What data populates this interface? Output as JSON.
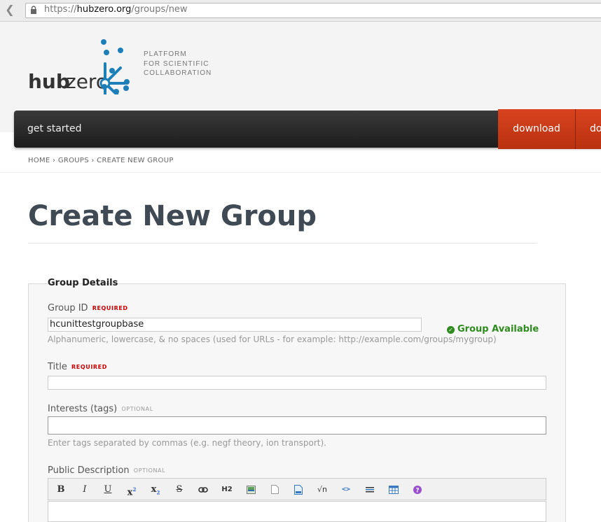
{
  "browser": {
    "url_prefix": "https://",
    "url_domain": "hubzero.org",
    "url_path": "/groups/new"
  },
  "header": {
    "logo_text_hub": "hub",
    "logo_text_zero": "zero",
    "tagline": [
      "PLATFORM",
      "FOR SCIENTIFIC",
      "COLLABORATION"
    ],
    "nav_label": "get started",
    "download_label": "download",
    "truncated_label": "do"
  },
  "breadcrumb": [
    "HOME",
    "GROUPS",
    "CREATE NEW GROUP"
  ],
  "page_title": "Create New Group",
  "form": {
    "legend": "Group Details",
    "group_id": {
      "label": "Group ID",
      "badge": "REQUIRED",
      "value": "hcunittestgroupbase",
      "hint": "Alphanumeric, lowercase, & no spaces (used for URLs - for example: http://example.com/groups/mygroup)",
      "status": "Group Available"
    },
    "title": {
      "label": "Title",
      "badge": "REQUIRED",
      "value": ""
    },
    "interests": {
      "label": "Interests (tags)",
      "badge": "OPTIONAL",
      "value": "",
      "hint": "Enter tags separated by commas (e.g. negf theory, ion transport)."
    },
    "description": {
      "label": "Public Description",
      "badge": "OPTIONAL"
    }
  },
  "toolbar": {
    "bold": "B",
    "italic": "I",
    "underline": "U",
    "superscript": "x",
    "subscript": "x",
    "strike": "S",
    "heading": "H2",
    "math": "√n",
    "code": "<>",
    "icons": [
      "bold-icon",
      "italic-icon",
      "underline-icon",
      "superscript-icon",
      "subscript-icon",
      "strikethrough-icon",
      "link-icon",
      "heading-icon",
      "image-icon",
      "file-icon",
      "page-icon",
      "math-icon",
      "code-icon",
      "horizontal-rule-icon",
      "table-icon",
      "help-icon"
    ]
  },
  "colors": {
    "accent": "#c9391a",
    "success": "#2e8b1e",
    "required": "#cc0000",
    "logo_blue": "#1c7fb7",
    "title": "#3f4a55"
  }
}
